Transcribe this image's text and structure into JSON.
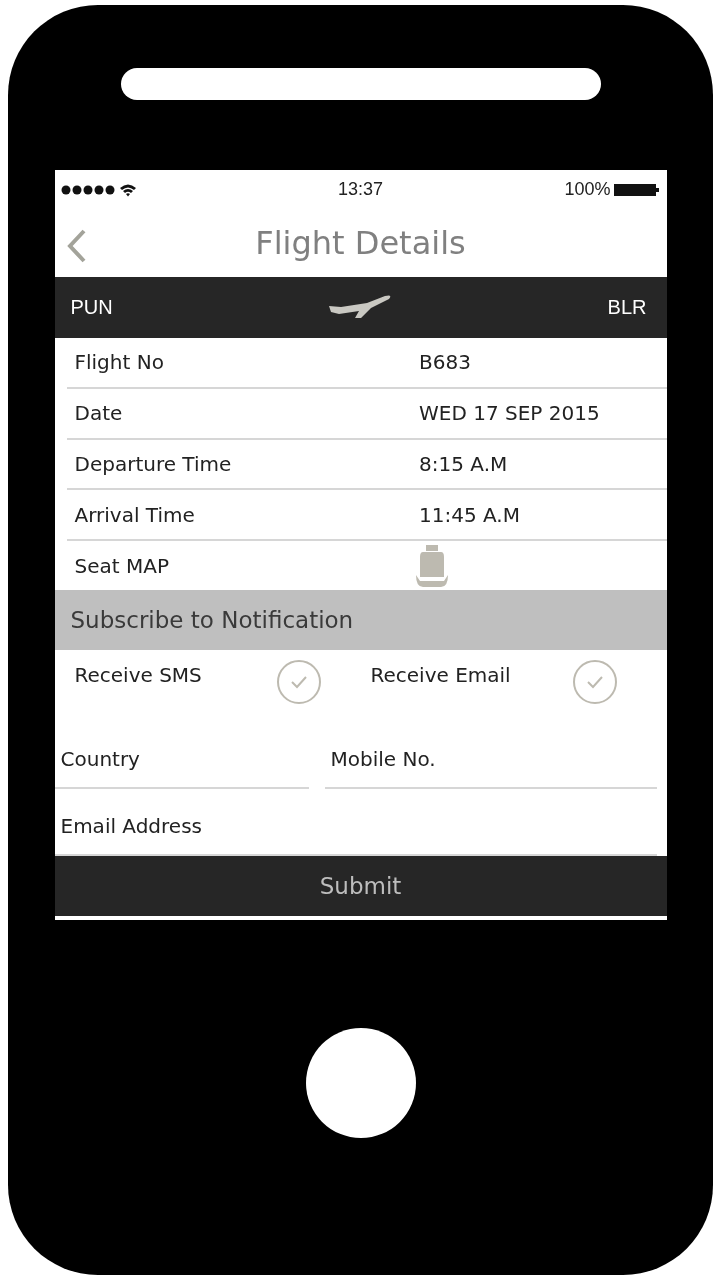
{
  "status_bar": {
    "time": "13:37",
    "battery": "100%"
  },
  "header": {
    "title": "Flight  Details"
  },
  "route": {
    "from": "PUN",
    "to": "BLR"
  },
  "details": [
    {
      "label": "Flight No",
      "value": "B683",
      "kind": "text"
    },
    {
      "label": "Date",
      "value": "WED 17 SEP 2015",
      "kind": "text"
    },
    {
      "label": "Departure Time",
      "value": "8:15 A.M",
      "kind": "text"
    },
    {
      "label": "Arrival Time",
      "value": "11:45 A.M",
      "kind": "text"
    },
    {
      "label": "Seat MAP",
      "kind": "seat"
    }
  ],
  "subscribe": {
    "title": "Subscribe to Notification",
    "options": [
      {
        "label": "Receive SMS",
        "checked": false
      },
      {
        "label": "Receive Email",
        "checked": false
      }
    ]
  },
  "fields": [
    {
      "placeholder": "Country"
    },
    {
      "placeholder": "Mobile No."
    },
    {
      "placeholder": "Email Address"
    }
  ],
  "submit": "Submit"
}
